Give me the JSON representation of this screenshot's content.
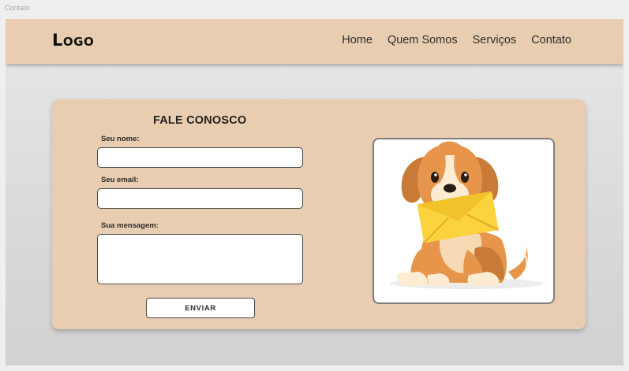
{
  "artboard": {
    "label": "Contato"
  },
  "header": {
    "logo": "Logo",
    "nav": [
      {
        "label": "Home"
      },
      {
        "label": "Quem Somos"
      },
      {
        "label": "Serviços"
      },
      {
        "label": "Contato"
      }
    ]
  },
  "form": {
    "title": "FALE CONOSCO",
    "name_label": "Seu nome:",
    "name_value": "",
    "email_label": "Seu email:",
    "email_value": "",
    "message_label": "Sua mensagem:",
    "message_value": "",
    "submit_label": "ENVIAR"
  },
  "illustration": {
    "icon": "dog-with-envelope-icon",
    "colors": {
      "fur": "#e7954a",
      "fur_dark": "#c97a36",
      "muzzle": "#fdebd2",
      "envelope": "#fbd33f",
      "envelope_flap": "#f2c22b"
    }
  },
  "colors": {
    "header_bg": "#e8cdb0",
    "card_bg": "#e8cdb0",
    "page_bg": "#e3e3e3"
  }
}
